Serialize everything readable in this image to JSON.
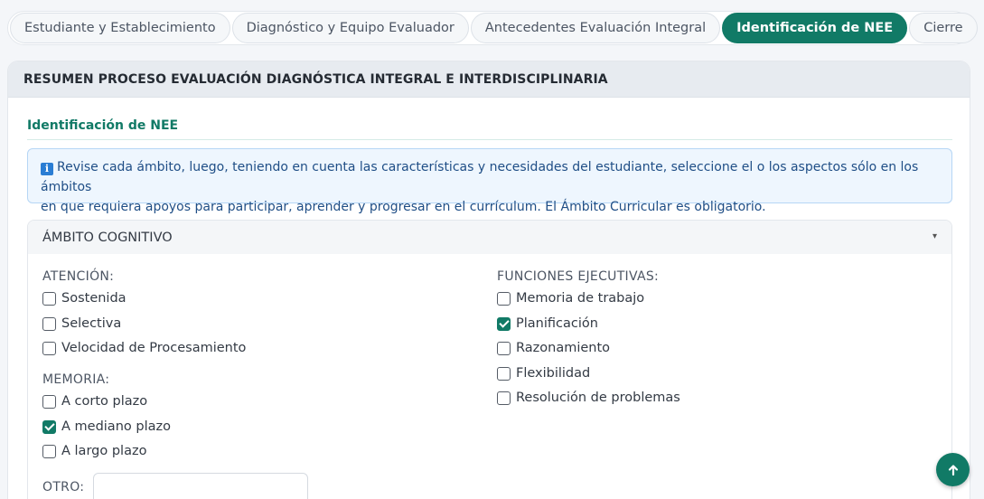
{
  "tabs": [
    {
      "label": "Estudiante y Establecimiento",
      "active": false
    },
    {
      "label": "Diagnóstico y Equipo Evaluador",
      "active": false
    },
    {
      "label": "Antecedentes Evaluación Integral",
      "active": false
    },
    {
      "label": "Identificación de NEE",
      "active": true
    },
    {
      "label": "Cierre",
      "active": false
    }
  ],
  "card": {
    "header": "RESUMEN PROCESO EVALUACIÓN DIAGNÓSTICA INTEGRAL E INTERDISCIPLINARIA",
    "section_title": "Identificación de NEE",
    "info_icon": "i",
    "info_line1": "Revise cada ámbito, luego, teniendo en cuenta las características y necesidades del estudiante, seleccione el o los aspectos sólo en los ámbitos",
    "info_line2": "en que requiera apoyos para participar, aprender y progresar en el currículum. El Ámbito Curricular es obligatorio."
  },
  "panel": {
    "title": "ÁMBITO COGNITIVO",
    "chevron": "▾",
    "atencion": {
      "label": "ATENCIÓN:",
      "items": [
        {
          "label": "Sostenida",
          "checked": false
        },
        {
          "label": "Selectiva",
          "checked": false
        },
        {
          "label": "Velocidad de Procesamiento",
          "checked": false
        }
      ]
    },
    "memoria": {
      "label": "MEMORIA:",
      "items": [
        {
          "label": "A corto plazo",
          "checked": false
        },
        {
          "label": "A mediano plazo",
          "checked": true
        },
        {
          "label": "A largo plazo",
          "checked": false
        }
      ]
    },
    "funciones": {
      "label": "FUNCIONES EJECUTIVAS:",
      "items": [
        {
          "label": "Memoria de trabajo",
          "checked": false
        },
        {
          "label": "Planificación",
          "checked": true
        },
        {
          "label": "Razonamiento",
          "checked": false
        },
        {
          "label": "Flexibilidad",
          "checked": false
        },
        {
          "label": "Resolución de problemas",
          "checked": false
        }
      ]
    },
    "otro": {
      "label": "OTRO:",
      "value": ""
    }
  },
  "colors": {
    "accent": "#117a66",
    "info_bg": "#eef6fe",
    "info_text": "#1f4e86"
  },
  "icons": {
    "scroll_top": "arrow-up-icon",
    "info": "info-icon",
    "chevron": "chevron-down-icon"
  }
}
